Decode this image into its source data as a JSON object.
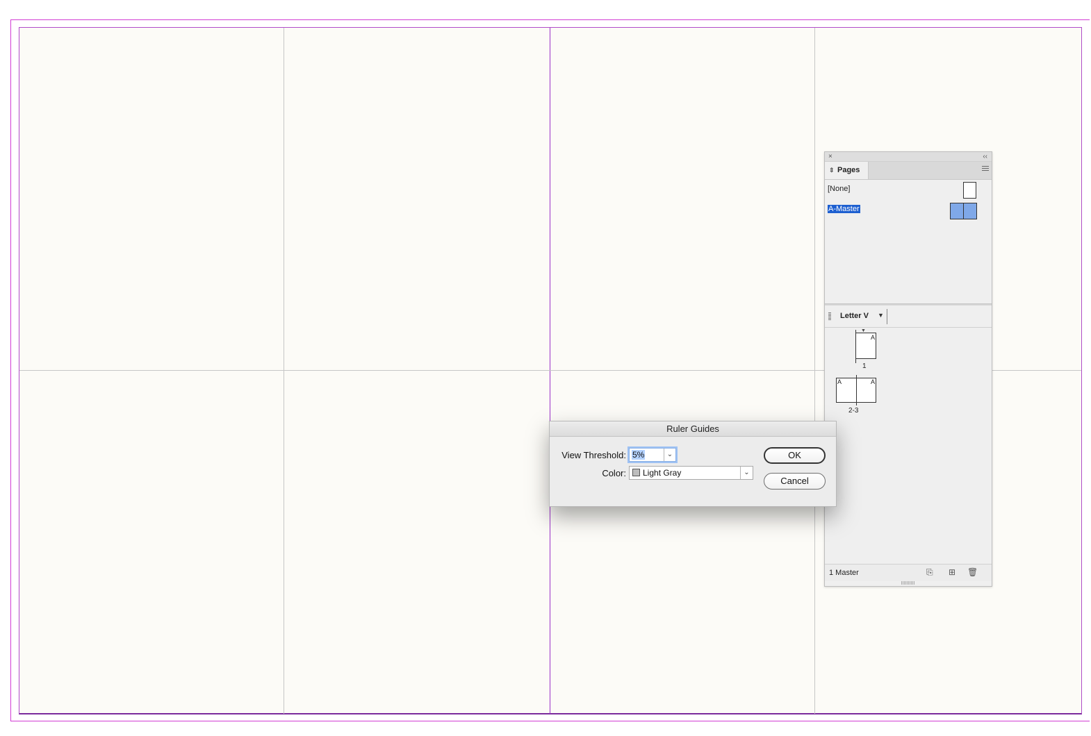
{
  "colors": {
    "bleed": "#d23bd4",
    "margin": "#9b30c9",
    "guide": "#c6c6c6",
    "page_bg": "#fcfbf7",
    "selection": "#1d5fd0",
    "master_thumb": "#7fa8e8",
    "light_gray_swatch": "#bdbdbd"
  },
  "pages_panel": {
    "close_icon": "×",
    "collapse_icon": "‹‹",
    "tab_label": "Pages",
    "masters": [
      {
        "name": "[None]"
      },
      {
        "name": "A-Master"
      }
    ],
    "page_size": "Letter V",
    "pages": [
      {
        "number": "1",
        "master_letters": [
          "A"
        ]
      },
      {
        "number": "2-3",
        "master_letters": [
          "A",
          "A"
        ]
      }
    ],
    "footer_text": "1 Master",
    "footer_icons": [
      "edit-page-size-icon",
      "new-page-icon",
      "delete-page-icon"
    ]
  },
  "dialog": {
    "title": "Ruler Guides",
    "view_threshold_label": "View Threshold:",
    "view_threshold_value": "5%",
    "color_label": "Color:",
    "color_value": "Light Gray",
    "ok_label": "OK",
    "cancel_label": "Cancel"
  }
}
